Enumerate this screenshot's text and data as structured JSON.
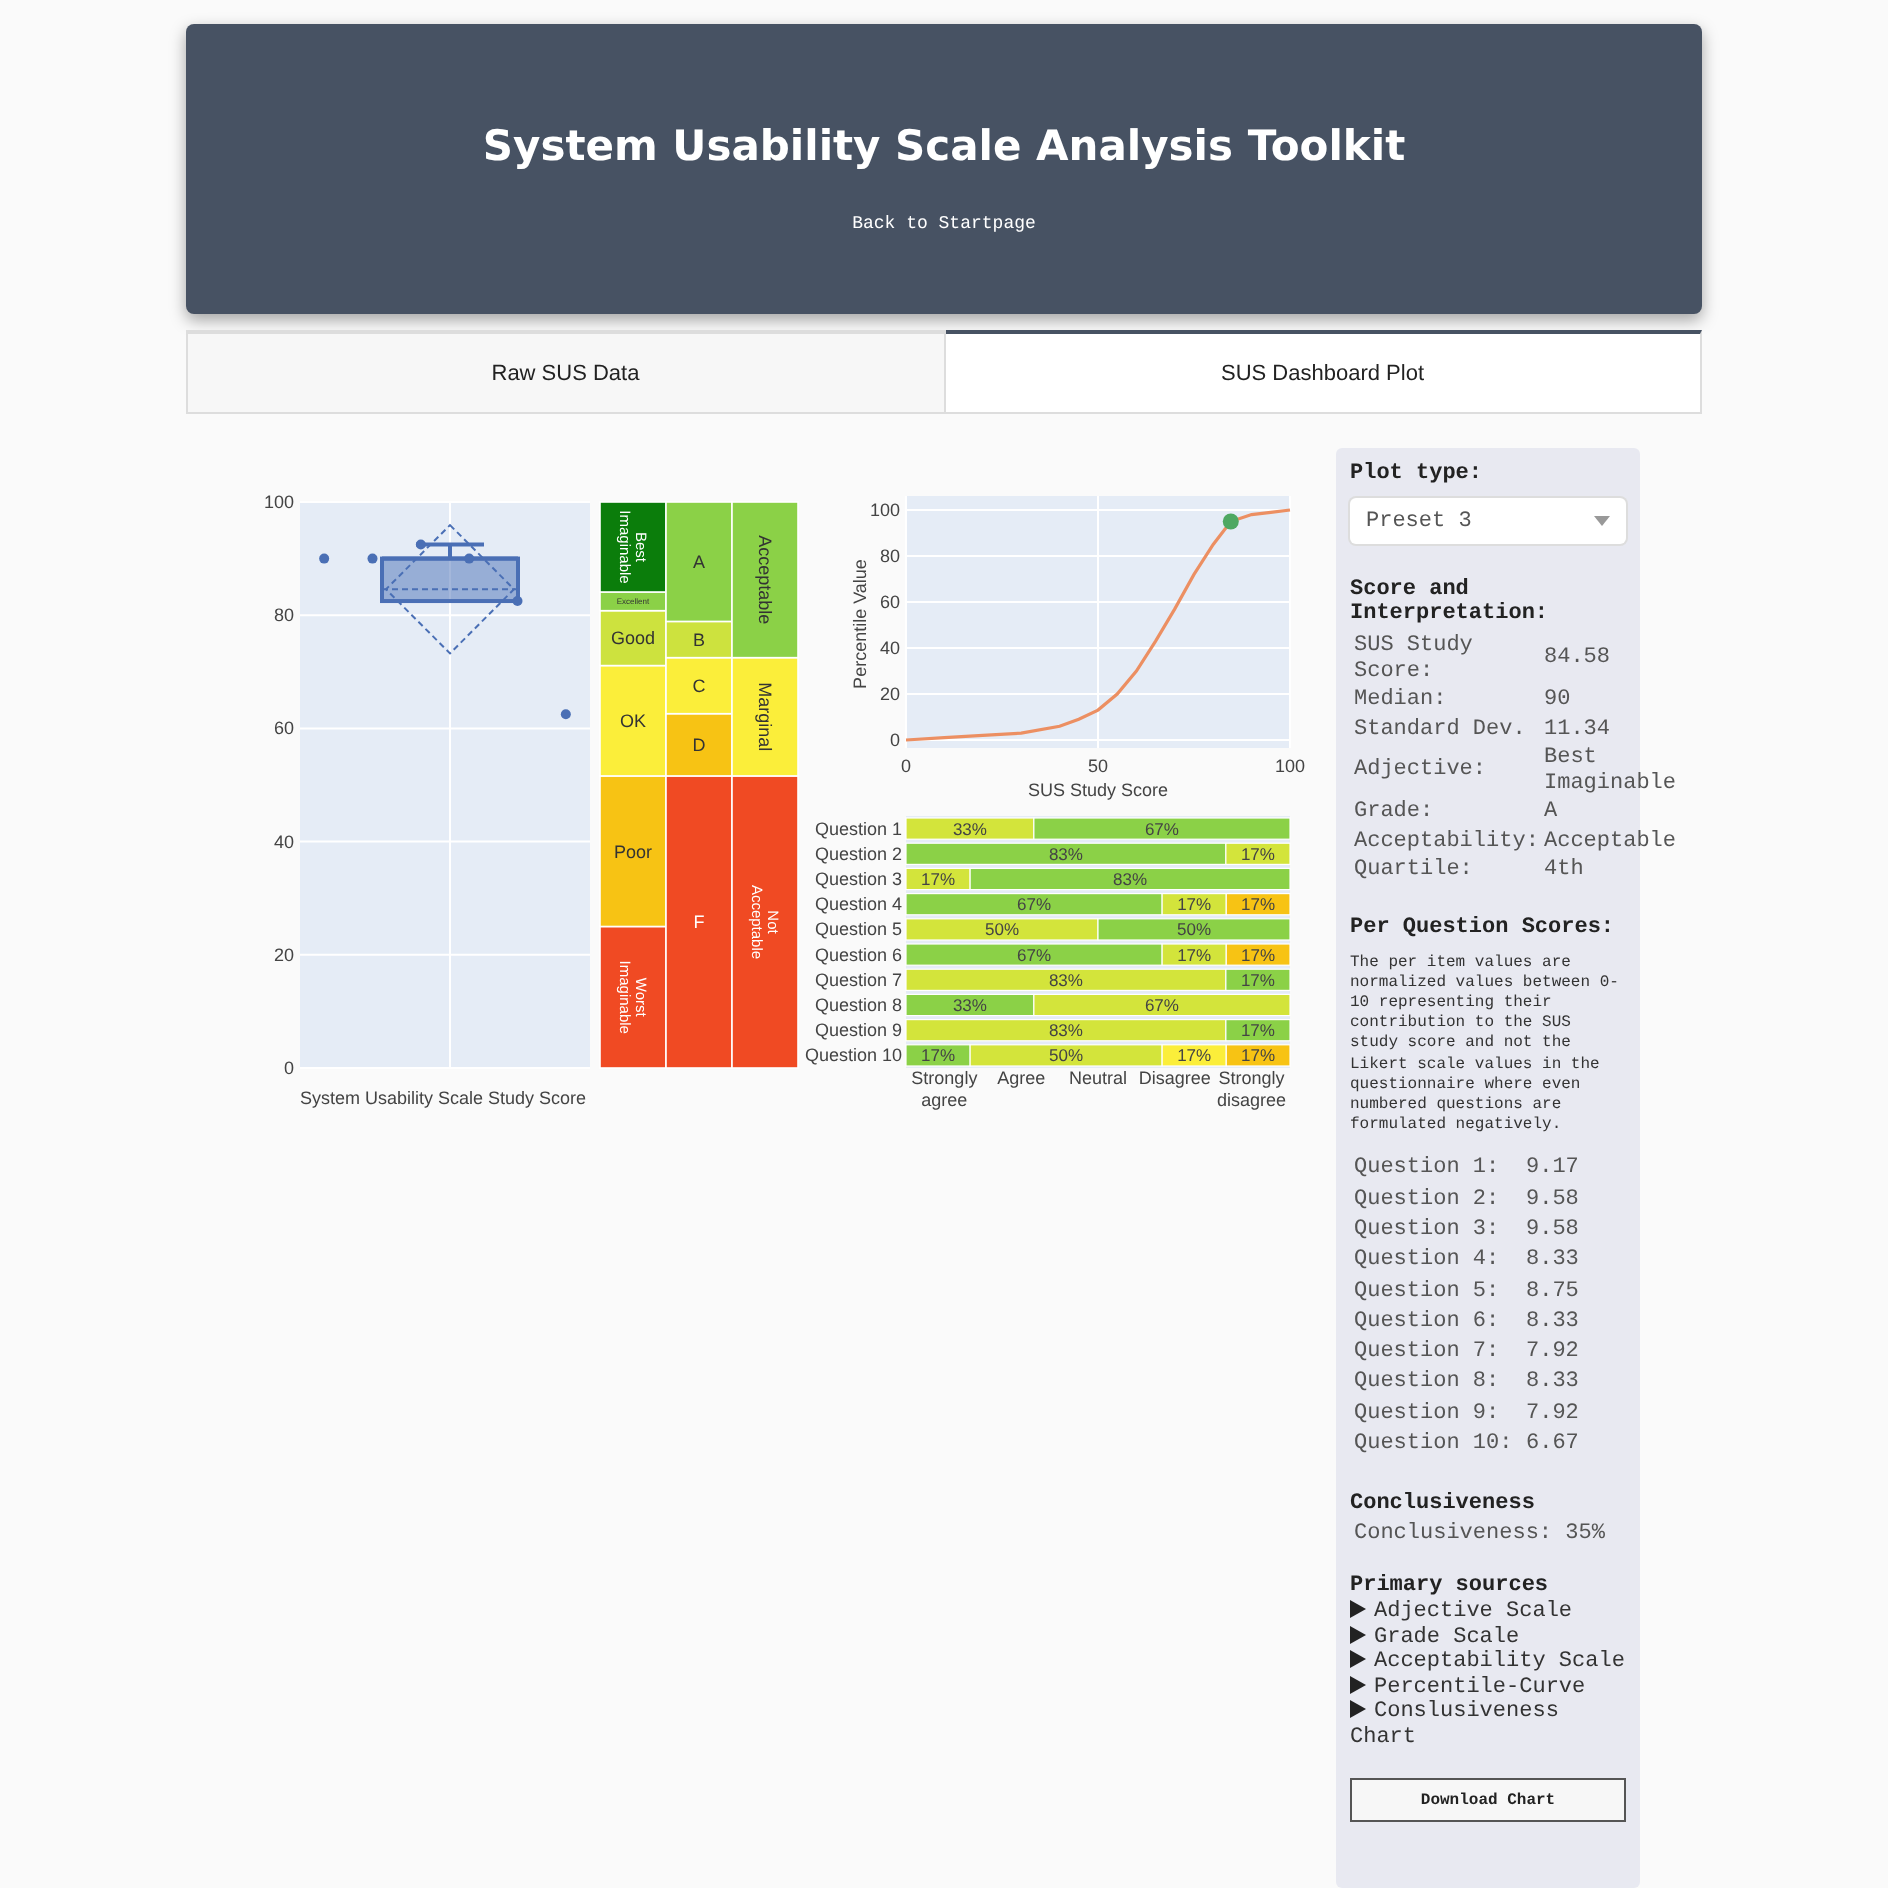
{
  "header": {
    "title": "System Usability Scale Analysis Toolkit",
    "link": "Back to Startpage"
  },
  "tabs": [
    {
      "label": "Raw SUS Data",
      "selected": false
    },
    {
      "label": "SUS Dashboard Plot",
      "selected": true
    }
  ],
  "box_plot": {
    "chart_data": {
      "type": "scatter",
      "xlabel": "System Usability Scale Study Score",
      "grid": true,
      "ylim": [
        0,
        100
      ],
      "yticks": [
        0,
        20,
        40,
        60,
        80,
        100
      ],
      "ref_lines": [
        {
          "axis": "y",
          "value": 90
        },
        {
          "axis": "y",
          "value": 84.58
        }
      ],
      "categories": [
        null,
        null,
        null,
        null,
        null,
        null
      ],
      "series": [
        {
          "color": "#4a6fb5",
          "values": [
            90,
            90,
            92.5,
            90,
            82.5,
            62.5
          ]
        }
      ]
    }
  },
  "scale_bands": {
    "chart_data": {
      "type": "bar",
      "stacked": true,
      "ylim": [
        0,
        100
      ],
      "series": [
        {
          "name": "Worst Imaginable",
          "color": "#f04a23",
          "values": [
            25,
            null,
            null
          ]
        },
        {
          "name": "Poor",
          "color": "#f7c314",
          "values": [
            26.6,
            null,
            null
          ]
        },
        {
          "name": "OK",
          "color": "#fbee3a",
          "values": [
            19.5,
            null,
            null
          ]
        },
        {
          "name": "Good",
          "color": "#cde23e",
          "values": [
            9.7,
            null,
            null
          ]
        },
        {
          "name": "Excellent",
          "color": "#8bd147",
          "values": [
            3.3,
            null,
            null
          ]
        },
        {
          "name": "Best Imaginable",
          "color": "#0b7d0b",
          "values": [
            15.9,
            null,
            null
          ]
        },
        {
          "name": "F",
          "color": "#f04a23",
          "values": [
            null,
            51.6,
            null
          ]
        },
        {
          "name": "D",
          "color": "#f7c314",
          "values": [
            null,
            11,
            null
          ]
        },
        {
          "name": "C",
          "color": "#fbee3a",
          "values": [
            null,
            9.9,
            null
          ]
        },
        {
          "name": "B",
          "color": "#cde23e",
          "values": [
            null,
            6.4,
            null
          ]
        },
        {
          "name": "A",
          "color": "#8bd147",
          "values": [
            null,
            21.1,
            null
          ]
        },
        {
          "name": "Not Acceptable",
          "color": "#f04a23",
          "values": [
            null,
            null,
            51.6
          ]
        },
        {
          "name": "Marginal",
          "color": "#fbee3a",
          "values": [
            null,
            null,
            20.9
          ]
        },
        {
          "name": "Acceptable",
          "color": "#8bd147",
          "values": [
            null,
            null,
            27.5
          ]
        }
      ]
    }
  },
  "percentile_curve": {
    "chart_data": {
      "type": "line",
      "xlabel": "SUS Study Score",
      "ylabel": "Percentile Value",
      "grid": true,
      "xlim": [
        0,
        100
      ],
      "ylim": [
        0,
        100
      ],
      "xticks": [
        0,
        50,
        100
      ],
      "yticks": [
        0,
        20,
        40,
        60,
        80,
        100
      ],
      "x": [
        0,
        10,
        20,
        30,
        40,
        45,
        50,
        55,
        60,
        65,
        70,
        75,
        80,
        84.58,
        90,
        95,
        100
      ],
      "series": [
        {
          "color": "#ec8f62",
          "values": [
            0,
            1,
            2,
            3,
            6,
            9,
            13,
            20,
            30,
            43,
            57,
            72,
            85,
            95,
            98,
            99,
            100
          ]
        },
        {
          "color": "#4ea862",
          "marker": true,
          "values": [
            null,
            null,
            null,
            null,
            null,
            null,
            null,
            null,
            null,
            null,
            null,
            null,
            null,
            95,
            null,
            null,
            null
          ]
        }
      ]
    }
  },
  "question_bars": {
    "chart_data": {
      "type": "bar",
      "orientation": "horizontal",
      "stacked": true,
      "xlim": [
        0,
        100
      ],
      "categories": [
        "Question 1",
        "Question 2",
        "Question 3",
        "Question 4",
        "Question 5",
        "Question 6",
        "Question 7",
        "Question 8",
        "Question 9",
        "Question 10"
      ],
      "series": [
        {
          "color": "#d3e43b",
          "values": [
            33.3,
            null,
            16.7,
            null,
            50,
            null,
            83.3,
            null,
            83.3,
            null
          ],
          "value_labels": [
            "33%",
            null,
            "17%",
            null,
            "50%",
            null,
            "83%",
            null,
            "83%",
            null
          ]
        },
        {
          "color": "#8bd147",
          "values": [
            66.7,
            83.3,
            83.3,
            66.7,
            50,
            66.7,
            16.7,
            33.3,
            16.7,
            16.7
          ],
          "value_labels": [
            "67%",
            "83%",
            "83%",
            "67%",
            "50%",
            "67%",
            "17%",
            "33%",
            "17%",
            "17%"
          ]
        },
        {
          "color": "#d3e43b",
          "values": [
            null,
            16.7,
            null,
            16.7,
            null,
            16.7,
            null,
            66.7,
            null,
            50
          ],
          "value_labels": [
            null,
            "17%",
            null,
            "17%",
            null,
            "17%",
            null,
            "67%",
            null,
            "50%"
          ]
        },
        {
          "color": "#fbee3a",
          "values": [
            null,
            null,
            null,
            null,
            null,
            null,
            null,
            null,
            null,
            16.7
          ],
          "value_labels": [
            null,
            null,
            null,
            null,
            null,
            null,
            null,
            null,
            null,
            "17%"
          ]
        },
        {
          "color": "#f7c314",
          "values": [
            null,
            null,
            null,
            16.6,
            null,
            16.6,
            null,
            null,
            null,
            16.6
          ],
          "value_labels": [
            null,
            null,
            null,
            "17%",
            null,
            "17%",
            null,
            null,
            null,
            "17%"
          ]
        }
      ]
    }
  },
  "response_labels": [
    "Strongly agree",
    "Agree",
    "Neutral",
    "Disagree",
    "Strongly disagree"
  ],
  "sidebar": {
    "plot_type_label": "Plot type:",
    "plot_type": "Preset 3",
    "score_heading": "Score and Interpretation:",
    "scores": [
      {
        "label": "SUS Study Score:",
        "value": "84.58"
      },
      {
        "label": "Median:",
        "value": "90"
      },
      {
        "label": "Standard Dev.",
        "value": "11.34"
      },
      {
        "label": "Adjective:",
        "value": "Best Imaginable"
      },
      {
        "label": "Grade:",
        "value": "A"
      },
      {
        "label": "Acceptability:",
        "value": "Acceptable"
      },
      {
        "label": "Quartile:",
        "value": "4th"
      }
    ],
    "per_question_heading": "Per Question Scores:",
    "per_question_note": "The per item values are normalized values between 0-10 representing their contribution to the SUS study score and not the Likert scale values in the questionnaire where even numbered questions are formulated negatively.",
    "question_scores": [
      {
        "label": "Question 1:",
        "value": "9.17"
      },
      {
        "label": "Question 2:",
        "value": "9.58"
      },
      {
        "label": "Question 3:",
        "value": "9.58"
      },
      {
        "label": "Question 4:",
        "value": "8.33"
      },
      {
        "label": "Question 5:",
        "value": "8.75"
      },
      {
        "label": "Question 6:",
        "value": "8.33"
      },
      {
        "label": "Question 7:",
        "value": "7.92"
      },
      {
        "label": "Question 8:",
        "value": "8.33"
      },
      {
        "label": "Question 9:",
        "value": "7.92"
      },
      {
        "label": "Question 10:",
        "value": "6.67"
      }
    ],
    "conclusiveness_heading": "Conclusiveness",
    "conclusiveness": {
      "label": "Conclusiveness:",
      "value": "35%"
    },
    "sources_heading": "Primary sources",
    "sources": [
      {
        "label": "Adjective Scale",
        "expanded": false
      },
      {
        "label": "Grade Scale",
        "expanded": false
      },
      {
        "label": "Acceptability Scale",
        "expanded": false
      },
      {
        "label": "Percentile-Curve",
        "expanded": false
      },
      {
        "label": "Conslusiveness Chart",
        "expanded": false
      }
    ],
    "download_button": "Download Chart"
  }
}
